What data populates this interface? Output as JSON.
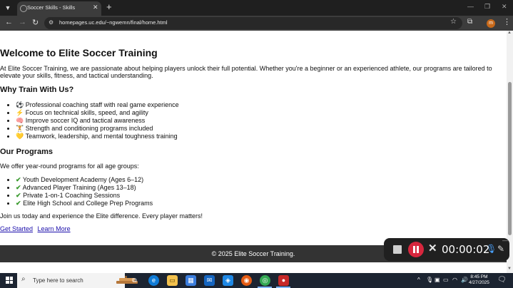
{
  "browser": {
    "tab_title": "Soccer Skills - Skills",
    "url": "homepages.uc.edu/~ngwemn/final/home.html"
  },
  "page": {
    "title": "Welcome to Elite Soccer Training",
    "intro": "At Elite Soccer Training, we are passionate about helping players unlock their full potential. Whether you're a beginner or an experienced athlete, our programs are tailored to elevate your skills, fitness, and tactical understanding.",
    "why_heading": "Why Train With Us?",
    "why_items": [
      {
        "icon": "⚽",
        "text": "Professional coaching staff with real game experience"
      },
      {
        "icon": "⚡",
        "text": "Focus on technical skills, speed, and agility"
      },
      {
        "icon": "🧠",
        "text": "Improve soccer IQ and tactical awareness"
      },
      {
        "icon": "🏋",
        "text": "Strength and conditioning programs included"
      },
      {
        "icon": "💛",
        "text": "Teamwork, leadership, and mental toughness training"
      }
    ],
    "programs_heading": "Our Programs",
    "programs_intro": "We offer year-round programs for all age groups:",
    "program_items": [
      {
        "icon": "✔",
        "text": "Youth Development Academy (Ages 6–12)"
      },
      {
        "icon": "✔",
        "text": "Advanced Player Training (Ages 13–18)"
      },
      {
        "icon": "✔",
        "text": "Private 1-on-1 Coaching Sessions"
      },
      {
        "icon": "✔",
        "text": "Elite High School and College Prep Programs"
      }
    ],
    "closing": "Join us today and experience the Elite difference. Every player matters!",
    "link_get_started": "Get Started",
    "link_learn_more": "Learn More",
    "footer": "© 2025 Elite Soccer Training."
  },
  "recorder": {
    "time": "00:00:02"
  },
  "taskbar": {
    "search_placeholder": "Type here to search",
    "time": "8:45 PM",
    "date": "4/27/2025"
  },
  "colors": {
    "check_green": "#3a9a2e",
    "link_blue": "#1a0dab",
    "footer_bg": "#333333",
    "recorder_red": "#d7263d"
  }
}
